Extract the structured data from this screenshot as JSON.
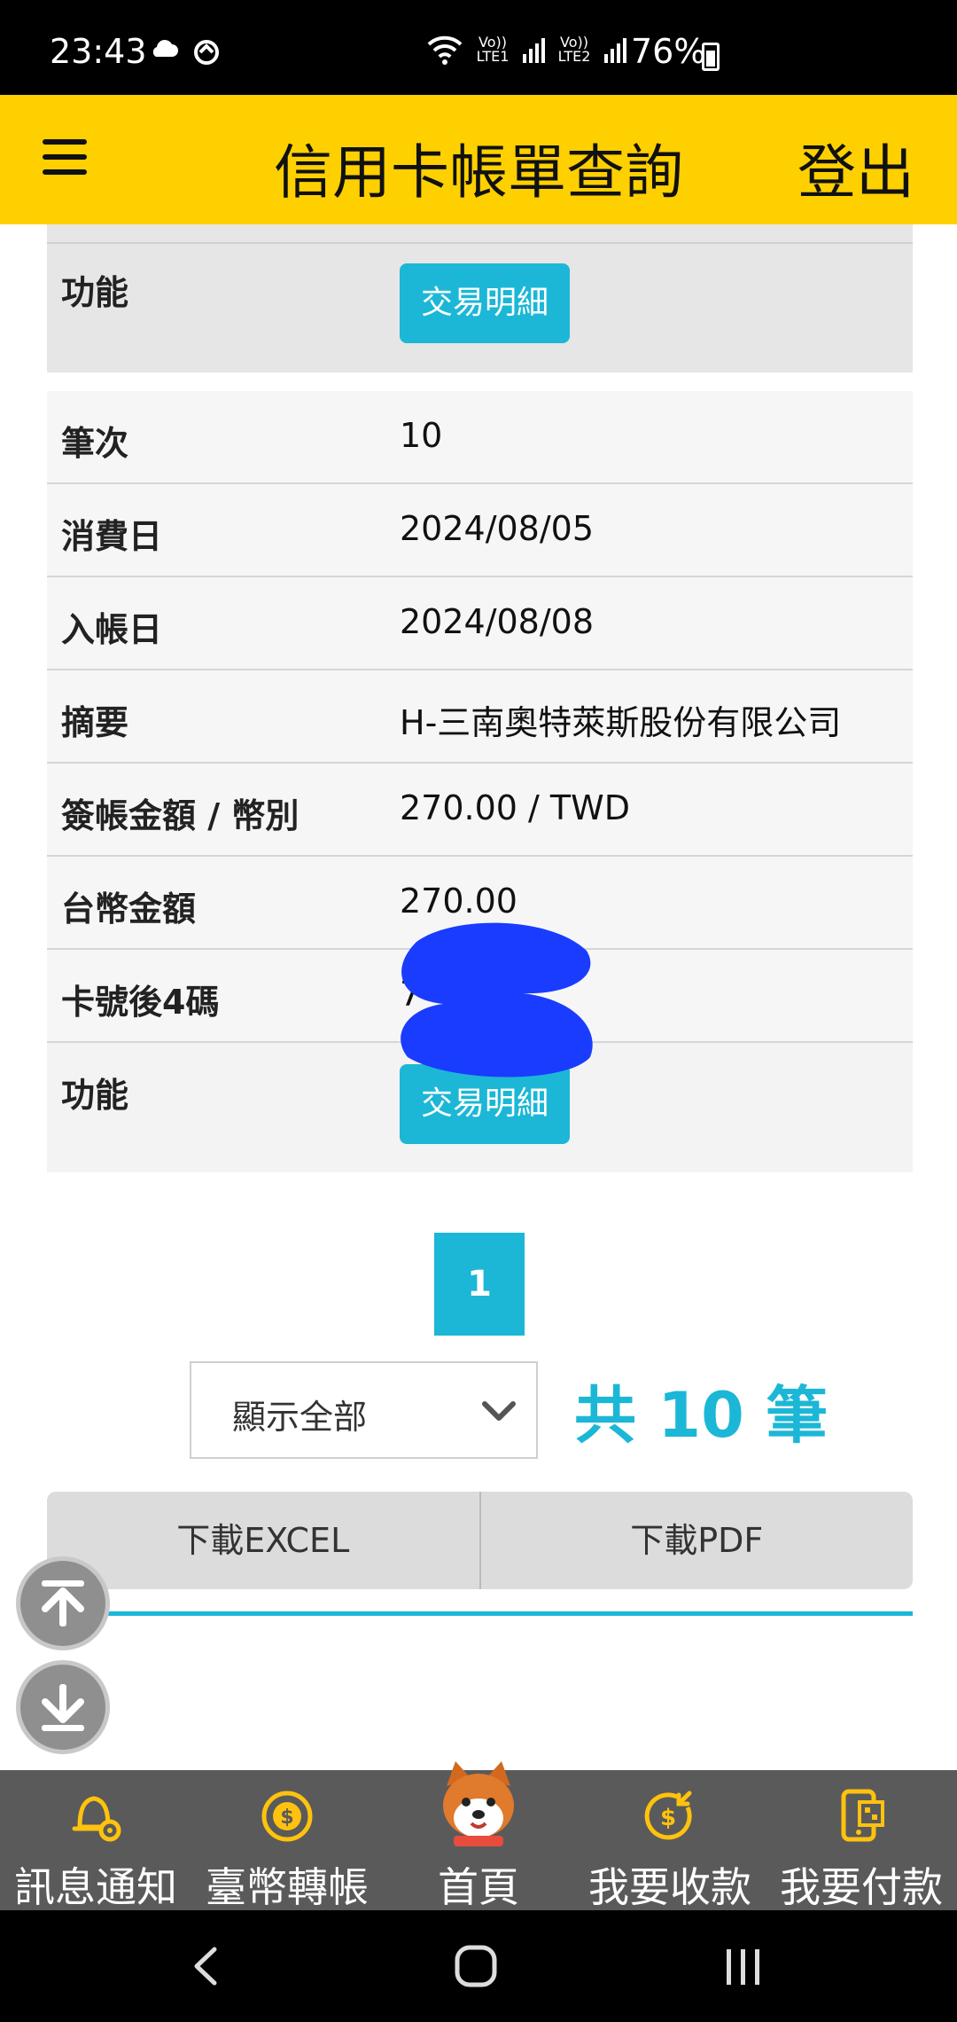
{
  "status_bar": {
    "time": "23:43",
    "battery": "76%",
    "lte1": "Vo)) LTE1",
    "lte2": "Vo)) LTE2"
  },
  "header": {
    "title": "信用卡帳單查詢",
    "logout": "登出"
  },
  "previous_record": {
    "function_label": "功能",
    "detail_button": "交易明細"
  },
  "record": {
    "rows": [
      {
        "label": "筆次",
        "value": "10"
      },
      {
        "label": "消費日",
        "value": "2024/08/05"
      },
      {
        "label": "入帳日",
        "value": "2024/08/08"
      },
      {
        "label": "摘要",
        "value": "H-三南奧特萊斯股份有限公司"
      },
      {
        "label": "簽帳金額 / 幣別",
        "value": "270.00 / TWD"
      },
      {
        "label": "台幣金額",
        "value": "270.00"
      },
      {
        "label": "卡號後4碼",
        "value": "7"
      }
    ],
    "function_label": "功能",
    "detail_button": "交易明細"
  },
  "pagination": {
    "current_page": "1",
    "filter_selected": "顯示全部",
    "total": "共 10 筆"
  },
  "downloads": {
    "excel": "下載EXCEL",
    "pdf": "下載PDF"
  },
  "bottom_nav": [
    {
      "label": "訊息通知",
      "icon": "bell-gear-icon"
    },
    {
      "label": "臺幣轉帳",
      "icon": "dollar-coin-icon"
    },
    {
      "label": "首頁",
      "icon": "shiba-mascot-icon"
    },
    {
      "label": "我要收款",
      "icon": "receive-money-icon"
    },
    {
      "label": "我要付款",
      "icon": "pay-phone-icon"
    }
  ],
  "colors": {
    "header_bg": "#ffd000",
    "accent": "#1cb7d6",
    "nav_bg": "#5a5a5a",
    "nav_icon": "#ffc20e",
    "redaction": "#1a3cff"
  }
}
